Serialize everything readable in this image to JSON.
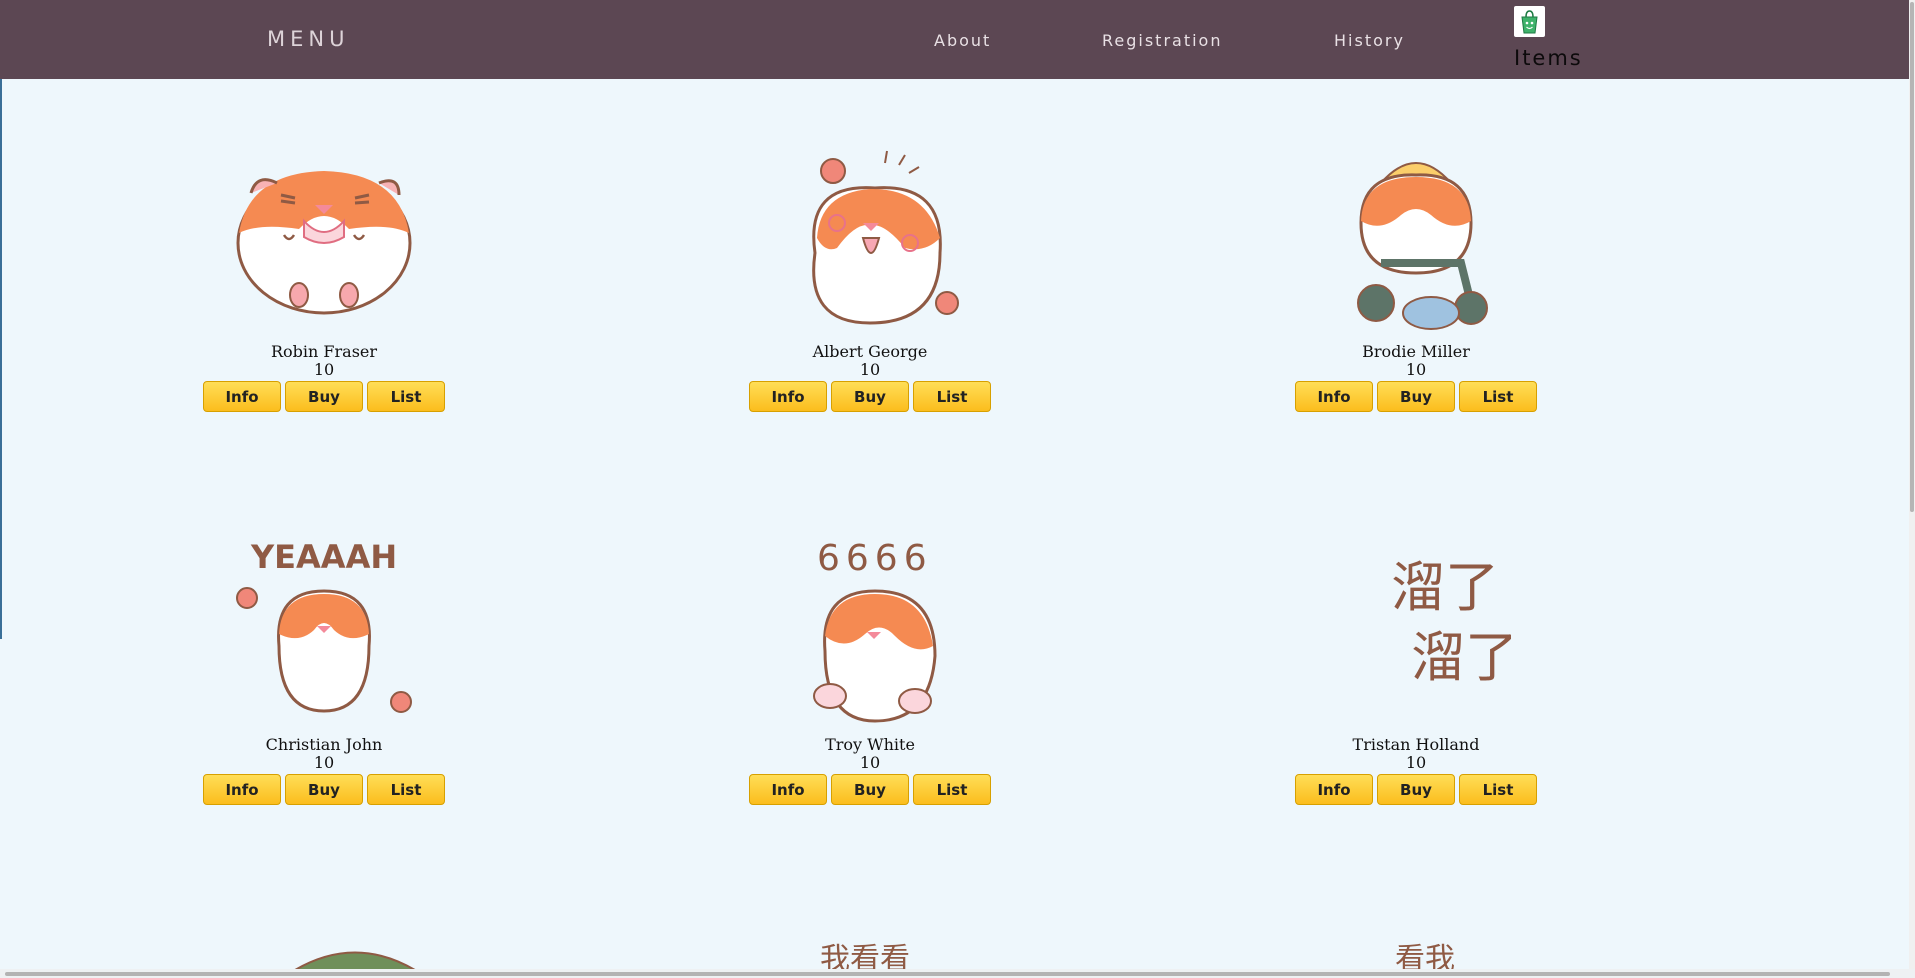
{
  "nav": {
    "brand": "MENU",
    "links": [
      "About",
      "Registration",
      "History"
    ],
    "cart_label": "Items",
    "cart_icon": "shopping-bag-icon"
  },
  "items": [
    {
      "name": "Robin Fraser",
      "price": "10"
    },
    {
      "name": "Albert George",
      "price": "10"
    },
    {
      "name": "Brodie Miller",
      "price": "10"
    },
    {
      "name": "Christian John",
      "price": "10"
    },
    {
      "name": "Troy White",
      "price": "10"
    },
    {
      "name": "Tristan Holland",
      "price": "10"
    }
  ],
  "buttons": {
    "info": "Info",
    "buy": "Buy",
    "list": "List"
  },
  "sticker_text": {
    "yeah": "YEAAAH",
    "six": "6666",
    "liu": "溜了",
    "partial_mid": "我看看",
    "partial_right": "看我"
  },
  "colors": {
    "nav_bg": "#5c4753",
    "page_bg": "#eef7fc",
    "button": "#fbc52b",
    "hamster_orange": "#f58a52",
    "outline_brown": "#8f5a44"
  }
}
